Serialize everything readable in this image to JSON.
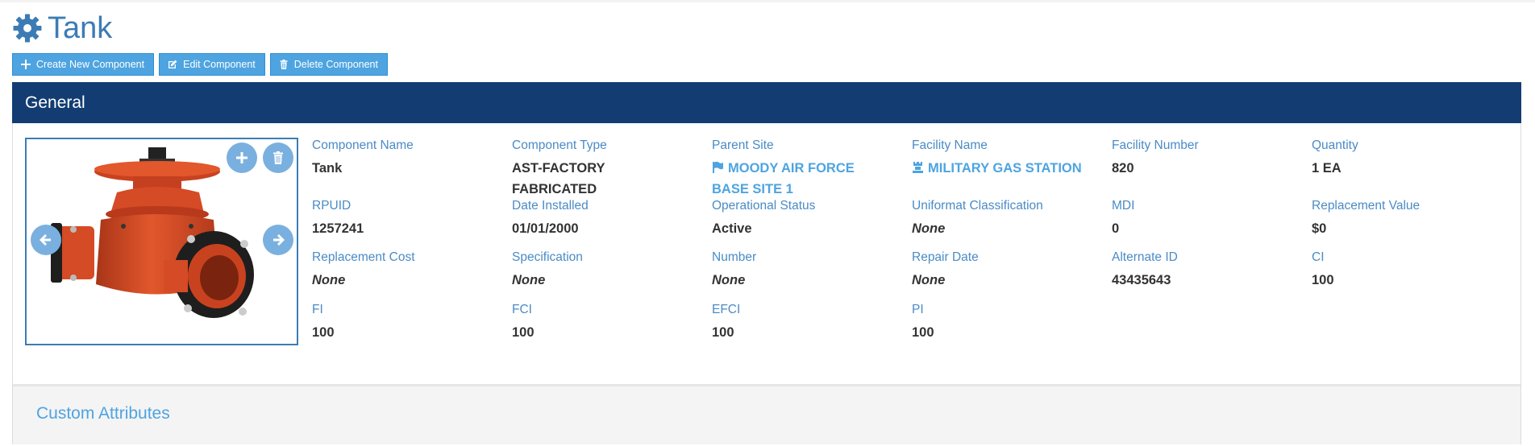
{
  "header": {
    "title": "Tank",
    "icon": "gear-icon"
  },
  "toolbar": {
    "create_label": "Create New Component",
    "edit_label": "Edit Component",
    "delete_label": "Delete Component"
  },
  "general": {
    "title": "General",
    "fields": {
      "component_name": {
        "label": "Component Name",
        "value": "Tank"
      },
      "component_type": {
        "label": "Component Type",
        "value": "AST-FACTORY FABRICATED"
      },
      "parent_site": {
        "label": "Parent Site",
        "value": "MOODY AIR FORCE BASE SITE 1"
      },
      "facility_name": {
        "label": "Facility Name",
        "value": "MILITARY GAS STATION"
      },
      "facility_number": {
        "label": "Facility Number",
        "value": "820"
      },
      "quantity": {
        "label": "Quantity",
        "value": "1 EA"
      },
      "rpuid": {
        "label": "RPUID",
        "value": "1257241"
      },
      "date_installed": {
        "label": "Date Installed",
        "value": "01/01/2000"
      },
      "operational_status": {
        "label": "Operational Status",
        "value": "Active"
      },
      "uniformat": {
        "label": "Uniformat Classification",
        "value": "None"
      },
      "mdi": {
        "label": "MDI",
        "value": "0"
      },
      "replacement_value": {
        "label": "Replacement Value",
        "value": "$0"
      },
      "replacement_cost": {
        "label": "Replacement Cost",
        "value": "None"
      },
      "specification": {
        "label": "Specification",
        "value": "None"
      },
      "number": {
        "label": "Number",
        "value": "None"
      },
      "repair_date": {
        "label": "Repair Date",
        "value": "None"
      },
      "alternate_id": {
        "label": "Alternate ID",
        "value": "43435643"
      },
      "ci": {
        "label": "CI",
        "value": "100"
      },
      "fi": {
        "label": "FI",
        "value": "100"
      },
      "fci": {
        "label": "FCI",
        "value": "100"
      },
      "efci": {
        "label": "EFCI",
        "value": "100"
      },
      "pi": {
        "label": "PI",
        "value": "100"
      }
    }
  },
  "custom_attributes": {
    "title": "Custom Attributes"
  },
  "colors": {
    "title_blue": "#3c7cb5",
    "button_blue": "#4ea4e0",
    "panel_header": "#133d72",
    "label_blue": "#4a8bc6"
  }
}
